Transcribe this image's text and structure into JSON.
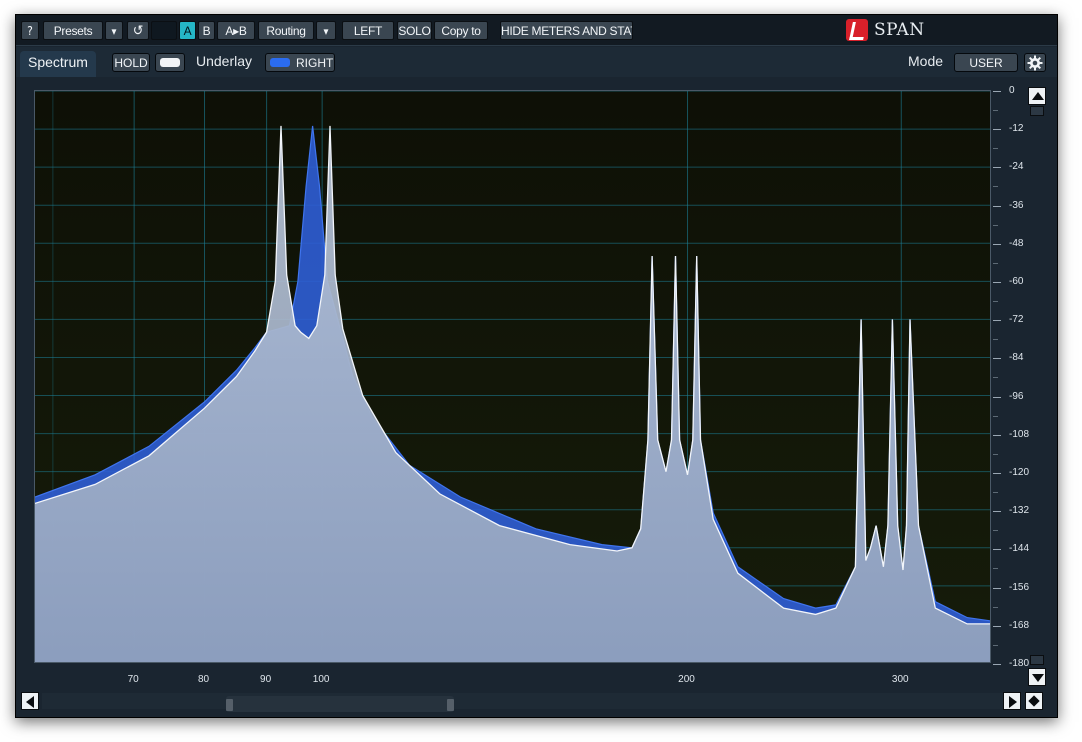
{
  "toolbar": {
    "help_label": "?",
    "presets_label": "Presets",
    "dropdown_glyph": "▾",
    "undo_glyph": "↺",
    "a_label": "A",
    "b_label": "B",
    "ab_label": "A▸B",
    "routing_label": "Routing",
    "left_label": "LEFT",
    "solo_label": "SOLO",
    "copyto_label": "Copy to",
    "hide_label": "HIDE METERS AND STATS"
  },
  "brand": {
    "name": "SPAN",
    "logo_color": "#d8202a"
  },
  "tabs": {
    "spectrum": "Spectrum"
  },
  "controls": {
    "hold_label": "HOLD",
    "underlay_label": "Underlay",
    "right_label": "RIGHT",
    "mode_label": "Mode",
    "mode_value": "USER",
    "settings_icon": "gear-icon"
  },
  "colors": {
    "background": "#1a2530",
    "plot_bg_top": "#0e1006",
    "plot_bg_bottom": "#161c0a",
    "main_fill": "#93a3bd",
    "underlay_fill": "#2f5ed6",
    "grid": "#1c7f96",
    "accent_cyan": "#25b6c6"
  },
  "chart_data": {
    "type": "area",
    "xlabel": "",
    "ylabel": "",
    "xscale": "log",
    "xlim": [
      58,
      355
    ],
    "ylim": [
      -180,
      0
    ],
    "x_ticks": [
      70,
      80,
      90,
      100,
      200,
      300
    ],
    "y_ticks": [
      0,
      -12,
      -24,
      -36,
      -48,
      -60,
      -72,
      -84,
      -96,
      -108,
      -120,
      -132,
      -144,
      -156,
      -168,
      -180
    ],
    "grid": true,
    "series": [
      {
        "role": "main",
        "x": [
          58,
          65,
          72,
          80,
          85,
          88,
          90,
          91.5,
          92.5,
          93.5,
          95,
          96,
          97.5,
          99,
          100.5,
          101.5,
          102.5,
          104,
          108,
          115,
          125,
          140,
          160,
          175,
          180,
          183,
          185.5,
          187,
          189,
          192,
          194,
          195.5,
          197,
          200,
          202,
          203.5,
          205,
          210,
          220,
          240,
          255,
          265,
          275,
          278,
          280.5,
          283,
          286,
          290,
          292.5,
          295,
          298,
          301,
          303,
          305,
          310,
          320,
          340,
          355
        ],
        "y": [
          -130,
          -124,
          -115,
          -100,
          -90,
          -82,
          -76,
          -60,
          -11,
          -58,
          -74,
          -76,
          -78,
          -74,
          -58,
          -11,
          -58,
          -75,
          -96,
          -114,
          -127,
          -137,
          -143,
          -145,
          -144,
          -138,
          -110,
          -52,
          -110,
          -120,
          -110,
          -52,
          -110,
          -121,
          -110,
          -52,
          -110,
          -135,
          -152,
          -163,
          -165,
          -163,
          -150,
          -72,
          -148,
          -144,
          -137,
          -150,
          -137,
          -72,
          -137,
          -151,
          -137,
          -72,
          -137,
          -163,
          -168,
          -168
        ]
      },
      {
        "role": "underlay",
        "x": [
          58,
          65,
          72,
          80,
          85,
          88,
          90,
          92,
          94,
          95.5,
          97,
          98.2,
          99.5,
          101,
          103,
          106,
          110,
          118,
          130,
          150,
          170,
          180,
          183,
          185.5,
          187,
          189,
          192,
          194,
          195.5,
          197,
          200,
          202,
          203.5,
          205,
          210,
          220,
          240,
          255,
          265,
          275,
          278,
          280.5,
          283,
          286,
          290,
          292.5,
          295,
          298,
          301,
          303,
          305,
          310,
          320,
          340,
          355
        ],
        "y": [
          -128,
          -121,
          -112,
          -98,
          -88,
          -81,
          -76,
          -75,
          -74,
          -60,
          -30,
          -11,
          -30,
          -60,
          -72,
          -90,
          -103,
          -118,
          -128,
          -138,
          -143,
          -144,
          -138,
          -110,
          -52,
          -110,
          -120,
          -110,
          -52,
          -110,
          -121,
          -110,
          -52,
          -110,
          -133,
          -150,
          -160,
          -163,
          -162,
          -150,
          -72,
          -148,
          -144,
          -137,
          -150,
          -137,
          -72,
          -137,
          -151,
          -137,
          -72,
          -137,
          -161,
          -166,
          -167
        ]
      }
    ]
  }
}
